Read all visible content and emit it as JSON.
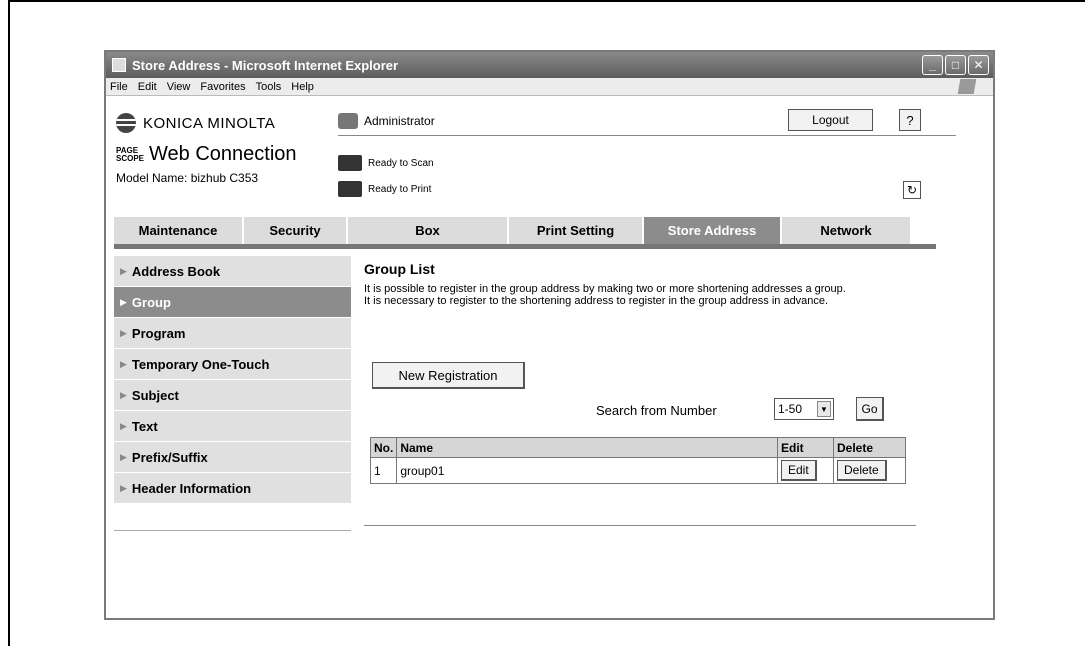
{
  "window": {
    "title": "Store Address - Microsoft Internet Explorer",
    "controls": {
      "minimize": "_",
      "maximize": "□",
      "close": "✕"
    }
  },
  "menu": {
    "items": [
      "File",
      "Edit",
      "View",
      "Favorites",
      "Tools",
      "Help"
    ]
  },
  "header": {
    "brand": "KONICA MINOLTA",
    "pagescope": "PAGE\nSCOPE",
    "web_connection": "Web Connection",
    "model_name": "Model Name: bizhub C353",
    "user": "Administrator",
    "logout_label": "Logout",
    "help_label": "?",
    "status_scan": "Ready to Scan",
    "status_print": "Ready to Print",
    "refresh_icon": "↻"
  },
  "tabs": [
    {
      "label": "Maintenance"
    },
    {
      "label": "Security"
    },
    {
      "label": "Box"
    },
    {
      "label": "Print Setting"
    },
    {
      "label": "Store Address"
    },
    {
      "label": "Network"
    }
  ],
  "sidebar": {
    "items": [
      {
        "label": "Address Book"
      },
      {
        "label": "Group"
      },
      {
        "label": "Program"
      },
      {
        "label": "Temporary One-Touch"
      },
      {
        "label": "Subject"
      },
      {
        "label": "Text"
      },
      {
        "label": "Prefix/Suffix"
      },
      {
        "label": "Header Information"
      }
    ]
  },
  "main": {
    "title": "Group List",
    "desc1": "It is possible to register in the group address by making two or more shortening addresses a group.",
    "desc2": "It is necessary to register to the shortening address to register in the group address in advance.",
    "new_registration": "New Registration",
    "search_label": "Search from Number",
    "search_value": "1-50",
    "go_label": "Go",
    "table": {
      "headers": [
        "No.",
        "Name",
        "Edit",
        "Delete"
      ],
      "rows": [
        {
          "no": "1",
          "name": "group01",
          "edit": "Edit",
          "delete": "Delete"
        }
      ]
    }
  }
}
